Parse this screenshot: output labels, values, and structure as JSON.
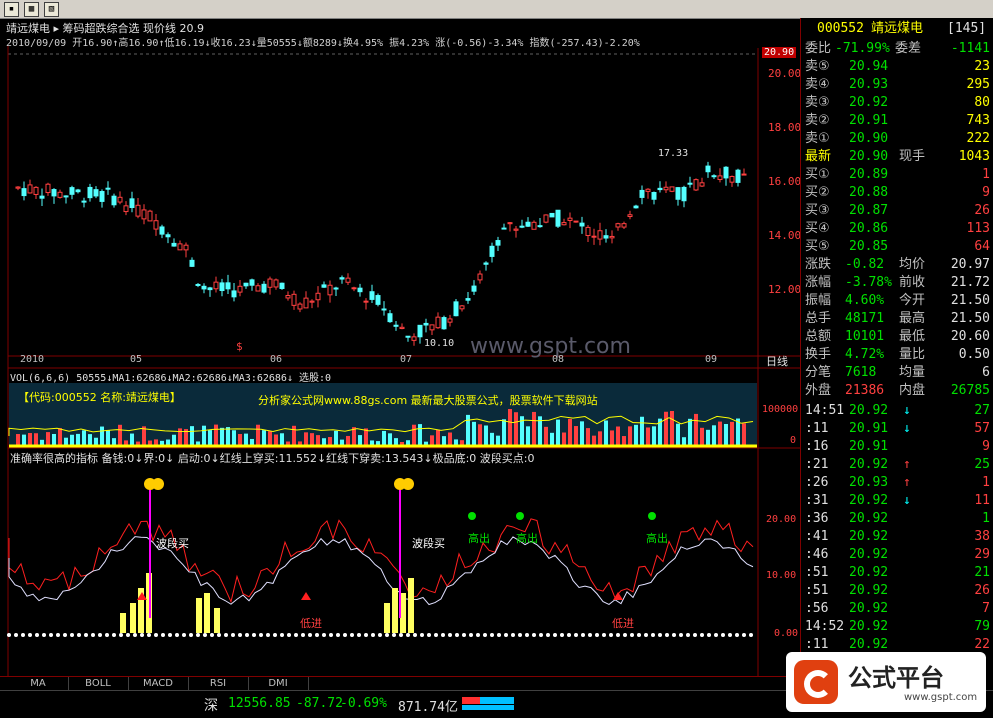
{
  "window": {
    "buttons": [
      "▪",
      "▦",
      "▧"
    ]
  },
  "header": {
    "line1": "靖远煤电  ▸ 筹码超跌综合选  现价线 20.9",
    "line2": "2010/09/09 开16.90↑高16.90↑低16.19↓收16.23↓量50555↓额8289↓换4.95% 振4.23% 涨(-0.56)-3.34% 指数(-257.43)-2.20%"
  },
  "price_axis": {
    "labels": [
      "20.00",
      "18.00",
      "16.00",
      "14.00",
      "12.00"
    ],
    "current": "20.90"
  },
  "annotations": {
    "high": "17.33",
    "low": "10.10",
    "signal": "$",
    "watermark": "www.gspt.com"
  },
  "time_axis": {
    "labels": [
      "2010",
      "05",
      "06",
      "07",
      "08",
      "09"
    ],
    "period": "日线"
  },
  "volume": {
    "header": "VOL(6,6,6) 50555↓MA1:62686↓MA2:62686↓MA3:62686↓ 选股:0",
    "banner": "【代码:000552 名称:靖远煤电】",
    "ad": "分析家公式网www.88gs.com 最新最大股票公式，股票软件下载网站",
    "axis": [
      "100000",
      "0"
    ]
  },
  "indicator": {
    "header": "准确率很高的指标 备钱:0↓界:0↓ 启动:0↓红线上穿买:11.552↓红线下穿卖:13.543↓极品底:0 波段买点:0",
    "axis": [
      "20.00",
      "10.00",
      "0.00"
    ],
    "labels": {
      "buy": "波段买",
      "high": "高出",
      "low": "低进"
    }
  },
  "tabs": [
    "MA",
    "BOLL",
    "MACD",
    "RSI",
    "DMI"
  ],
  "quote": {
    "code": "000552",
    "name": "靖远煤电",
    "num": "[145]",
    "ratio_label": "委比",
    "ratio": "-71.99%",
    "diff_label": "委差",
    "diff": "-1141",
    "sells": [
      {
        "label": "卖⑤",
        "price": "20.94",
        "vol": "23"
      },
      {
        "label": "卖④",
        "price": "20.93",
        "vol": "295"
      },
      {
        "label": "卖③",
        "price": "20.92",
        "vol": "80"
      },
      {
        "label": "卖②",
        "price": "20.91",
        "vol": "743"
      },
      {
        "label": "卖①",
        "price": "20.90",
        "vol": "222"
      }
    ],
    "latest_label": "最新",
    "latest": "20.90",
    "hand_label": "现手",
    "hand": "1043",
    "buys": [
      {
        "label": "买①",
        "price": "20.89",
        "vol": "1"
      },
      {
        "label": "买②",
        "price": "20.88",
        "vol": "9"
      },
      {
        "label": "买③",
        "price": "20.87",
        "vol": "26"
      },
      {
        "label": "买④",
        "price": "20.86",
        "vol": "113"
      },
      {
        "label": "买⑤",
        "price": "20.85",
        "vol": "64"
      }
    ],
    "stats": [
      {
        "l1": "涨跌",
        "v1": "-0.82",
        "l2": "均价",
        "v2": "20.97"
      },
      {
        "l1": "涨幅",
        "v1": "-3.78%",
        "l2": "前收",
        "v2": "21.72"
      },
      {
        "l1": "振幅",
        "v1": "4.60%",
        "l2": "今开",
        "v2": "21.50"
      },
      {
        "l1": "总手",
        "v1": "48171",
        "l2": "最高",
        "v2": "21.50"
      },
      {
        "l1": "总额",
        "v1": "10101",
        "l2": "最低",
        "v2": "20.60"
      },
      {
        "l1": "换手",
        "v1": "4.72%",
        "l2": "量比",
        "v2": "0.50"
      },
      {
        "l1": "分笔",
        "v1": "7618",
        "l2": "均量",
        "v2": "6"
      }
    ],
    "outer_label": "外盘",
    "outer": "21386",
    "inner_label": "内盘",
    "inner": "26785",
    "ticks": [
      {
        "t": "14:51",
        "p": "20.92",
        "a": "↓",
        "v": "27"
      },
      {
        "t": ":11",
        "p": "20.91",
        "a": "↓",
        "v": "57"
      },
      {
        "t": ":16",
        "p": "20.91",
        "a": "",
        "v": "9"
      },
      {
        "t": ":21",
        "p": "20.92",
        "a": "↑",
        "v": "25"
      },
      {
        "t": ":26",
        "p": "20.93",
        "a": "↑",
        "v": "1"
      },
      {
        "t": ":31",
        "p": "20.92",
        "a": "↓",
        "v": "11"
      },
      {
        "t": ":36",
        "p": "20.92",
        "a": "",
        "v": "1"
      },
      {
        "t": ":41",
        "p": "20.92",
        "a": "",
        "v": "38"
      },
      {
        "t": ":46",
        "p": "20.92",
        "a": "",
        "v": "29"
      },
      {
        "t": ":51",
        "p": "20.92",
        "a": "",
        "v": "21"
      },
      {
        "t": ":51",
        "p": "20.92",
        "a": "",
        "v": "26"
      },
      {
        "t": ":56",
        "p": "20.92",
        "a": "",
        "v": "7"
      },
      {
        "t": "14:52",
        "p": "20.92",
        "a": "",
        "v": "79"
      },
      {
        "t": ":11",
        "p": "20.92",
        "a": "",
        "v": "22"
      }
    ]
  },
  "status": {
    "market": "深",
    "index": "12556.85",
    "change": "-87.72",
    "pct": "-0.69%",
    "amount": "871.74亿"
  },
  "logo": {
    "text": "公式平台",
    "url": "www.gspt.com"
  }
}
